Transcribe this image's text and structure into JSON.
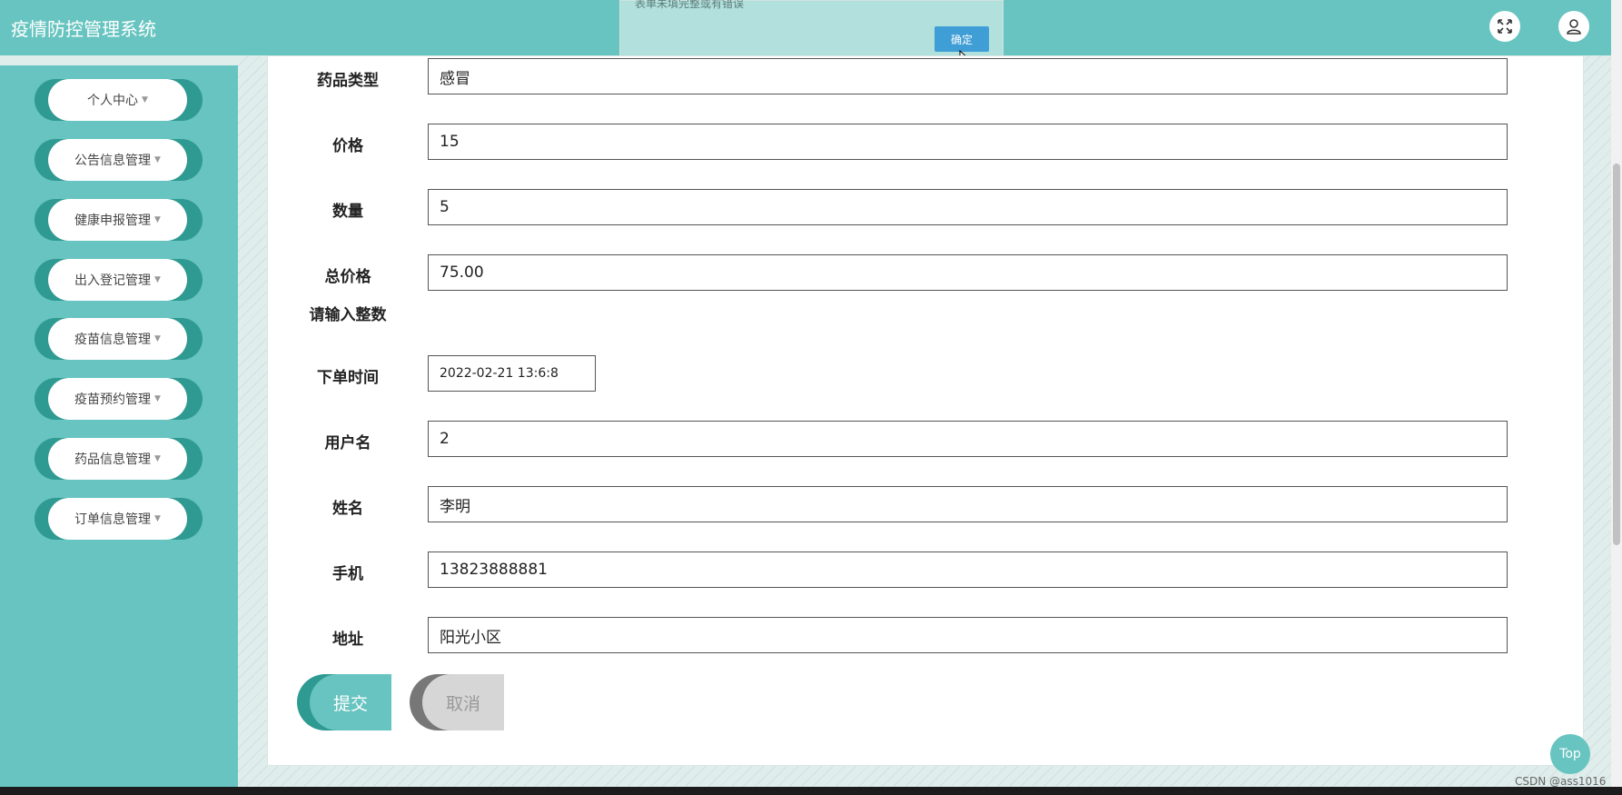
{
  "app": {
    "title": "疫情防控管理系统"
  },
  "header": {
    "icons": [
      "fullscreen-icon",
      "user-icon"
    ]
  },
  "sidebar": {
    "items": [
      {
        "label": "个人中心"
      },
      {
        "label": "公告信息管理"
      },
      {
        "label": "健康申报管理"
      },
      {
        "label": "出入登记管理"
      },
      {
        "label": "疫苗信息管理"
      },
      {
        "label": "疫苗预约管理"
      },
      {
        "label": "药品信息管理"
      },
      {
        "label": "订单信息管理"
      }
    ]
  },
  "form": {
    "drug_type": {
      "label": "药品类型",
      "value": "感冒"
    },
    "price": {
      "label": "价格",
      "value": "15"
    },
    "quantity": {
      "label": "数量",
      "value": "5"
    },
    "total_price": {
      "label": "总价格",
      "value": "75.00",
      "hint": "请输入整数"
    },
    "order_time": {
      "label": "下单时间",
      "value": "2022-02-21 13:6:8"
    },
    "username": {
      "label": "用户名",
      "value": "2"
    },
    "name": {
      "label": "姓名",
      "value": "李明"
    },
    "phone": {
      "label": "手机",
      "value": "13823888881"
    },
    "address": {
      "label": "地址",
      "value": "阳光小区"
    },
    "submit_label": "提交",
    "cancel_label": "取消"
  },
  "alert": {
    "message": "表单未填完整或有错误",
    "confirm_label": "确定"
  },
  "back_to_top_label": "Top",
  "watermark": "CSDN @ass1016",
  "colors": {
    "primary": "#67c4c0",
    "accent_dark": "#2f9a92",
    "dialog_button": "#3f9ed6"
  }
}
